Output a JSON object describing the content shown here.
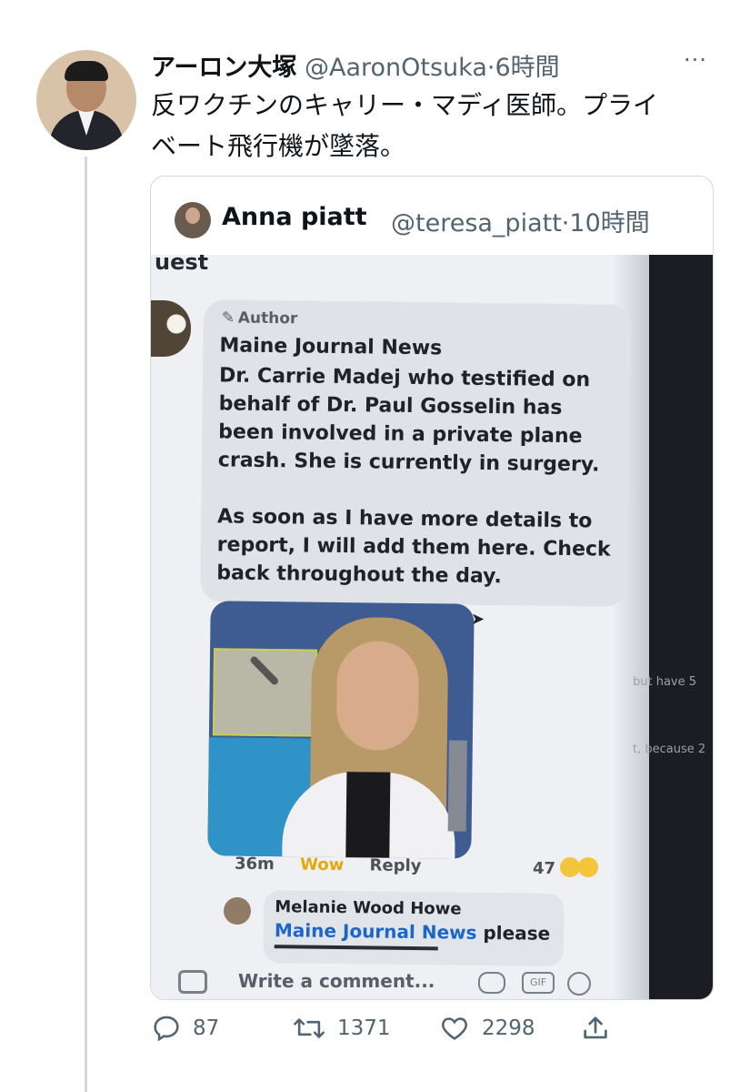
{
  "tweet": {
    "author_name": "アーロン大塚",
    "handle": "@AaronOtsuka",
    "separator": "·",
    "time": "6時間",
    "more": "···",
    "text_line1": "反ワクチンのキャリー・マディ医師。プライ",
    "text_line2": "ベート飛行機が墜落。"
  },
  "quote": {
    "author_name": "Anna piatt",
    "handle": "@teresa_piatt",
    "separator": "·",
    "time": "10時間"
  },
  "screenshot": {
    "cut_text": "uest",
    "author_badge": "Author",
    "source": "Maine Journal News",
    "body_lines": [
      "Dr. Carrie Madej who testified on",
      "behalf of Dr. Paul Gosselin has",
      "been involved in a private plane",
      "crash. She is currently in surgery.",
      "",
      "As soon as I have more details to",
      "report, I will add them here. Check",
      "back throughout the day."
    ],
    "time_ago": "36m",
    "wow": "Wow",
    "reply": "Reply",
    "reaction_count": "47",
    "reply_author": "Melanie Wood Howe",
    "reply_link": "Maine Journal News",
    "reply_text": " please",
    "comment_placeholder": "Write a comment...",
    "gif_label": "GIF",
    "faint_text_1": "but have 5",
    "faint_text_2": "t, because 2"
  },
  "stats": {
    "replies": "87",
    "retweets": "1371",
    "likes": "2298"
  },
  "colors": {
    "text": "#0f1419",
    "secondary": "#536471",
    "border": "#cfd9de",
    "link": "#1b66c9",
    "wow": "#e3a80b"
  }
}
